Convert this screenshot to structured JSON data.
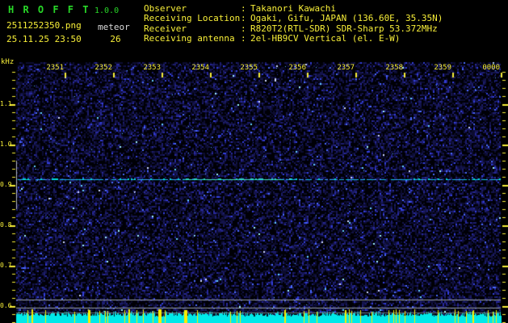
{
  "app": {
    "name": "H R O F F T",
    "version": "1.0.0"
  },
  "header": {
    "filename": "2511252350.png",
    "mode_label": "meteor",
    "timestamp": "25.11.25 23:50",
    "meteor_count": "26",
    "info_rows": [
      {
        "label": "Observer",
        "sep": ":",
        "value": "Takanori Kawachi"
      },
      {
        "label": "Receiving Location",
        "sep": ":",
        "value": "Ogaki, Gifu, JAPAN (136.60E, 35.35N)"
      },
      {
        "label": "Receiver",
        "sep": ":",
        "value": "R820T2(RTL-SDR) SDR-Sharp 53.372MHz"
      },
      {
        "label": "Receiving antenna",
        "sep": ":",
        "value": "2el-HB9CV Vertical (el. E-W)"
      }
    ]
  },
  "chart_data": {
    "type": "heatmap",
    "title": "HROFFT 10-minute radio meteor echo spectrogram (intensity vs time vs audio frequency)",
    "x_axis": {
      "position": "top",
      "unit": "time HHMM",
      "ticks": [
        "2351",
        "2352",
        "2353",
        "2354",
        "2355",
        "2356",
        "2357",
        "2358",
        "2359",
        "0000"
      ]
    },
    "y_axis": {
      "unit": "kHz",
      "ticks": [
        "1.1",
        "1.0",
        "0.9",
        "0.8",
        "0.7",
        "0.6"
      ],
      "minor_tick_step_khz": 0.02,
      "visible_range_khz": [
        0.56,
        1.18
      ],
      "ticks_mirrored_right": true
    },
    "grid": false,
    "legend": false,
    "background": "speckled dark-blue receiver noise floor over black",
    "features": [
      {
        "name": "continuous-carrier-line",
        "freq_khz": 0.914,
        "time_extent": "2351-0000 full width",
        "color": "#00dede",
        "description": "dashed/solid cyan-green horizontal trace of the direct carrier"
      },
      {
        "name": "left-edge-calibration-bar",
        "freq_span_khz": [
          0.84,
          0.96
        ],
        "color": "#b4b8c0",
        "description": "short vertical gray bar at left plot edge"
      },
      {
        "name": "horizontal-reference-line",
        "freq_khz": 0.616,
        "color": "#99a1a9"
      },
      {
        "name": "horizontal-reference-line",
        "freq_khz": 0.596,
        "color": "#99a1a9"
      },
      {
        "name": "signal-level-strip",
        "position": "bottom edge of plot",
        "fill_color": "#00e9e9",
        "event_tick_color": "#f8ee00",
        "description": "jagged cyan audio-level trace along full width with many thin yellow event ticks, two thick yellow marks near 2354"
      }
    ]
  },
  "colors": {
    "background": "#000000",
    "title_green": "#28d828",
    "text_yellow": "#f8ef38",
    "text_white": "#dcdcdc",
    "noise_bright_blue": "#3340e0",
    "carrier_cyan": "#00dede",
    "level_strip_cyan": "#00e9e9",
    "event_tick_yellow": "#f8ee00",
    "reference_gray": "#99a1a9"
  }
}
